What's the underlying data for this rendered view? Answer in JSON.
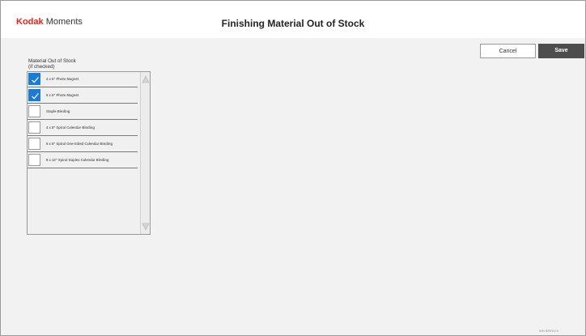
{
  "header": {
    "brand_part1": "Kodak",
    "brand_part2": "Moments",
    "title": "Finishing Material Out of Stock"
  },
  "actions": {
    "cancel_label": "Cancel",
    "save_label": "Save"
  },
  "material_list": {
    "title_line1": "Material Out of Stock",
    "title_line2": "(if checked)",
    "items": [
      {
        "label": "4 x 6\" Photo Magnet",
        "checked": true
      },
      {
        "label": "5 x 6\" Photo Magnet",
        "checked": true
      },
      {
        "label": "Staple Binding",
        "checked": false
      },
      {
        "label": "4 x 8\" Spiral Calendar Binding",
        "checked": false
      },
      {
        "label": "6 x 8\" Spiral One-Sided Calendar Binding",
        "checked": false
      },
      {
        "label": "8 x 12\" Spiral Duplex Calendar Binding",
        "checked": false
      }
    ]
  },
  "footer": {
    "version": "WH SPEV2.0"
  },
  "colors": {
    "brand_red": "#e1261c",
    "checkbox_blue": "#1f7ad3",
    "save_button": "#4d4d4d",
    "background": "#f2f2f2"
  }
}
